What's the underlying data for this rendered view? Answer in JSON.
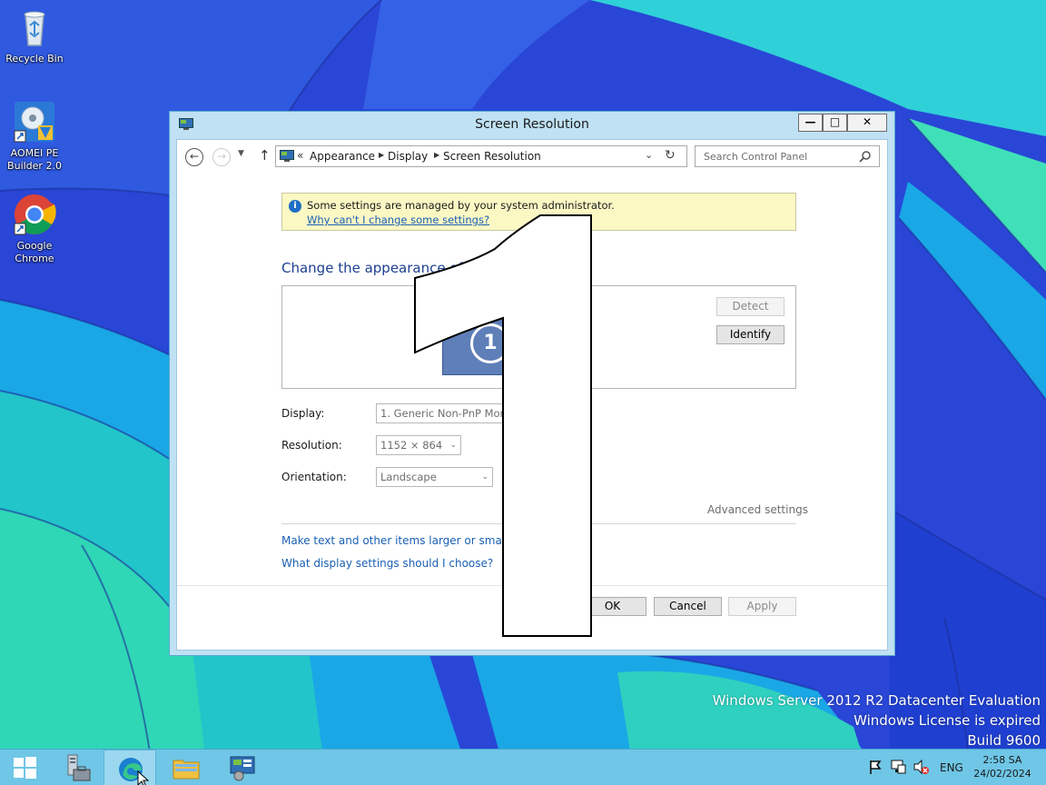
{
  "desktop": {
    "icons": [
      {
        "label": "Recycle Bin"
      },
      {
        "label": "AOMEI PE\nBuilder 2.0"
      },
      {
        "label": "Google\nChrome"
      }
    ]
  },
  "window": {
    "title": "Screen Resolution",
    "address": {
      "prefix": "«",
      "crumbs": [
        "Appearance",
        "Display",
        "Screen Resolution"
      ]
    },
    "search": {
      "placeholder": "Search Control Panel"
    },
    "info": {
      "message": "Some settings are managed by your system administrator.",
      "link": "Why can't I change some settings?"
    },
    "heading": "Change the appearance of your displays",
    "monitor_number": "1",
    "buttons": {
      "detect": "Detect",
      "identify": "Identify",
      "ok": "OK",
      "cancel": "Cancel",
      "apply": "Apply"
    },
    "fields": {
      "display_label": "Display:",
      "display_value": "1. Generic Non-PnP Monitor",
      "resolution_label": "Resolution:",
      "resolution_value": "1152 × 864",
      "orientation_label": "Orientation:",
      "orientation_value": "Landscape"
    },
    "advanced": "Advanced settings",
    "links": {
      "text_size": "Make text and other items larger or smaller",
      "help": "What display settings should I choose?"
    }
  },
  "identify_overlay": {
    "number": "1"
  },
  "watermark": {
    "line1": "Windows Server 2012 R2 Datacenter Evaluation",
    "line2": "Windows License is expired",
    "line3": "Build 9600"
  },
  "taskbar": {
    "language": "ENG",
    "time": "2:58 SA",
    "date": "24/02/2024"
  },
  "colors": {
    "taskbar": "#6fc6e6",
    "window_frame": "#bfe1f3",
    "link": "#1a5fb4",
    "heading": "#1e3f91",
    "info_bg": "#fbf8c4"
  }
}
